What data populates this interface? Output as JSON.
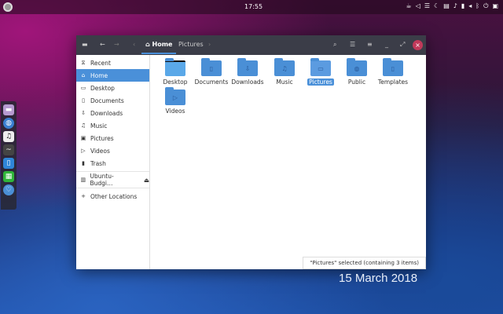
{
  "topbar": {
    "clock": "17:55",
    "tray_icons": [
      "coffee-icon",
      "network-icon",
      "menu-icon",
      "moon-icon",
      "clipboard-icon",
      "bell-icon",
      "battery-icon",
      "volume-icon",
      "bluetooth-icon",
      "power-icon",
      "show-desktop-icon"
    ]
  },
  "dock": {
    "apps": [
      "files",
      "browser",
      "music",
      "terminal",
      "documents",
      "spreadsheet",
      "settings"
    ]
  },
  "window": {
    "path": [
      "Home",
      "Pictures"
    ],
    "sidebar": [
      {
        "label": "Recent",
        "icon": "clock-icon"
      },
      {
        "label": "Home",
        "icon": "home-icon",
        "selected": true
      },
      {
        "label": "Desktop",
        "icon": "desktop-icon"
      },
      {
        "label": "Documents",
        "icon": "document-icon"
      },
      {
        "label": "Downloads",
        "icon": "download-icon"
      },
      {
        "label": "Music",
        "icon": "music-icon"
      },
      {
        "label": "Pictures",
        "icon": "picture-icon"
      },
      {
        "label": "Videos",
        "icon": "video-icon"
      },
      {
        "label": "Trash",
        "icon": "trash-icon"
      }
    ],
    "drive": "Ubuntu-Budgi…",
    "other": "Other Locations",
    "files": [
      {
        "name": "Desktop",
        "glyph": ""
      },
      {
        "name": "Documents",
        "glyph": "▯"
      },
      {
        "name": "Downloads",
        "glyph": "⇩"
      },
      {
        "name": "Music",
        "glyph": "♫"
      },
      {
        "name": "Pictures",
        "glyph": "▭",
        "selected": true
      },
      {
        "name": "Public",
        "glyph": "◍"
      },
      {
        "name": "Templates",
        "glyph": "▯"
      },
      {
        "name": "Videos",
        "glyph": "▷"
      }
    ],
    "status": "\"Pictures\" selected  (containing 3 items)"
  },
  "desktop": {
    "date": "15 March 2018"
  },
  "colors": {
    "accent": "#4a90d9",
    "header": "#3b3d48",
    "close": "#c0395a"
  }
}
